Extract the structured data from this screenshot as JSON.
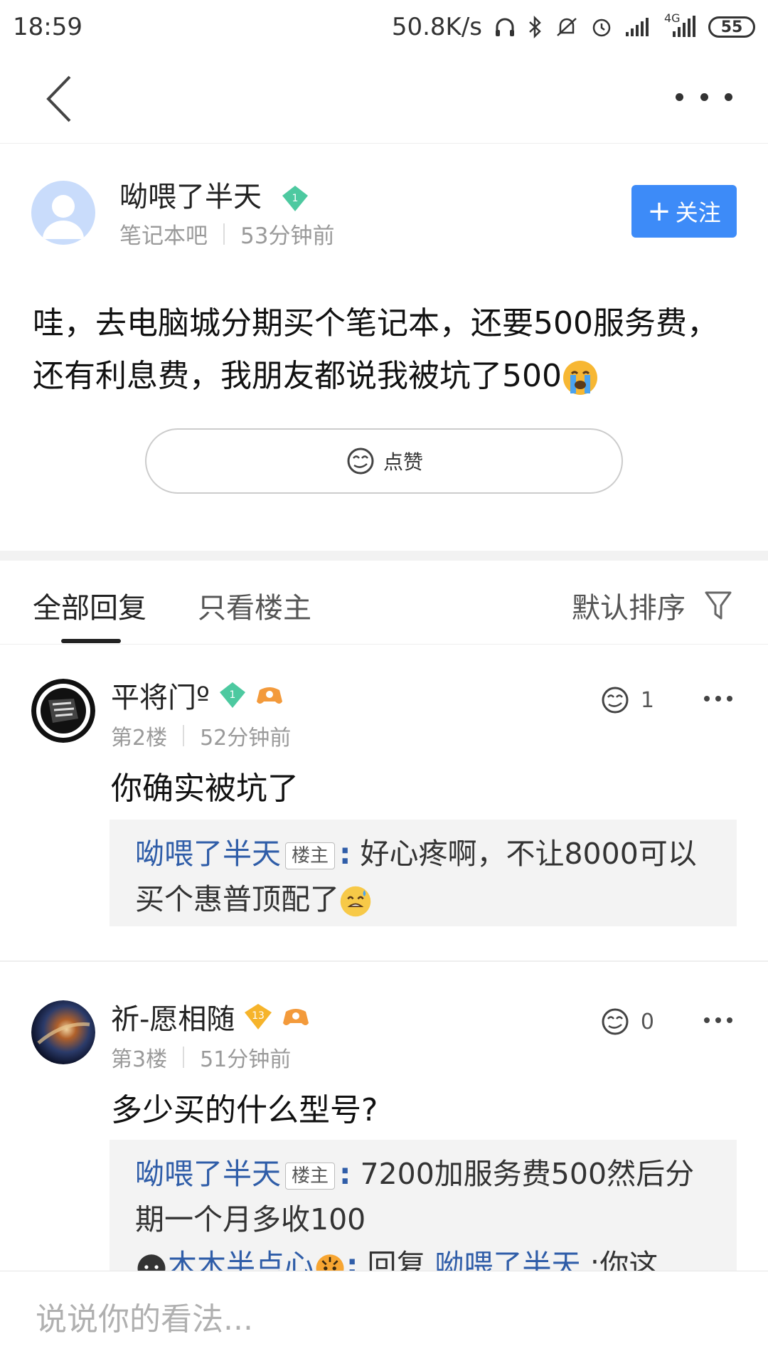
{
  "status_bar": {
    "time": "18:59",
    "network_speed": "50.8K/s",
    "network_type": "4G",
    "battery": "55",
    "icons": [
      "headphone-icon",
      "bluetooth-icon",
      "mute-icon",
      "alarm-icon",
      "signal-icon",
      "signal-4g-icon",
      "battery-icon"
    ]
  },
  "nav": {
    "back_icon": "back-arrow-icon",
    "more_icon": "more-icon"
  },
  "post": {
    "author_name": "呦喂了半天",
    "author_level": "1",
    "forum": "笔记本吧",
    "time": "53分钟前",
    "follow_label": "关注",
    "content": "哇，去电脑城分期买个笔记本，还要500服务费，还有利息费，我朋友都说我被坑了500",
    "like_label": "点赞"
  },
  "tabs": {
    "all_replies": "全部回复",
    "only_op": "只看楼主",
    "sort_label": "默认排序"
  },
  "replies": [
    {
      "user": "平将门º",
      "level": "1",
      "floor": "第2楼",
      "time": "52分钟前",
      "likes": "1",
      "text": "你确实被坑了",
      "sub": {
        "name": "呦喂了半天",
        "tag": "楼主",
        "content": "好心疼啊，不让8000可以买个惠普顶配了"
      }
    },
    {
      "user": "祈-愿相随",
      "level": "13",
      "floor": "第3楼",
      "time": "51分钟前",
      "likes": "0",
      "text": "多少买的什么型号?",
      "sub": {
        "name": "呦喂了半天",
        "tag": "楼主",
        "content": "7200加服务费500然后分期一个月多收100",
        "reply_user": "木木半点心",
        "reply_prefix": "回复",
        "reply_target": "呦喂了半天",
        "reply_text": ":你这"
      }
    }
  ],
  "bottom": {
    "placeholder": "说说你的看法..."
  },
  "colors": {
    "accent": "#3d8bf8",
    "link": "#2f5da8"
  }
}
